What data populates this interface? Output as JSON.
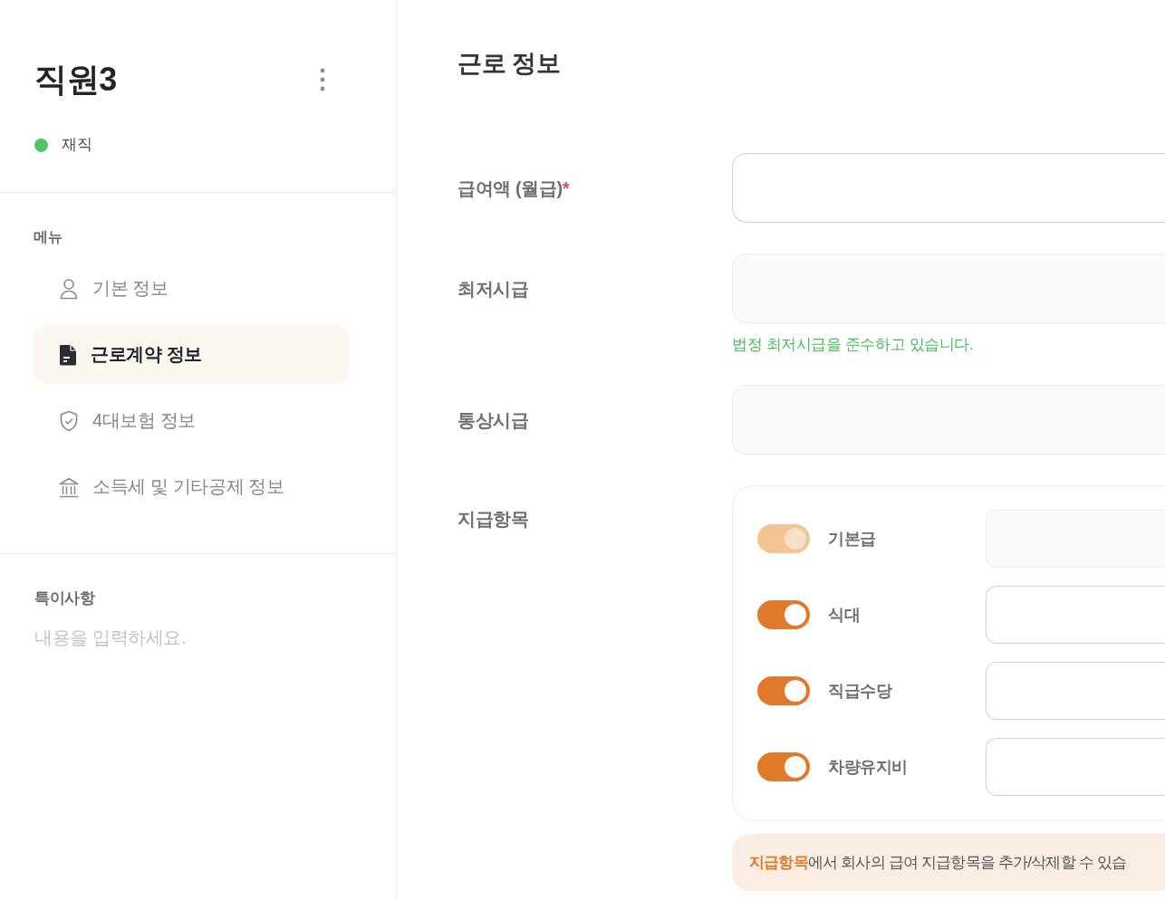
{
  "sidebar": {
    "employee_name": "직원3",
    "status": "재직",
    "menu_heading": "메뉴",
    "menu_items": [
      {
        "label": "기본 정보",
        "selected": false
      },
      {
        "label": "근로계약 정보",
        "selected": true
      },
      {
        "label": "4대보험 정보",
        "selected": false
      },
      {
        "label": "소득세 및 기타공제 정보",
        "selected": false
      }
    ],
    "notes": {
      "label": "특이사항",
      "placeholder": "내용을 입력하세요."
    }
  },
  "main": {
    "title": "근로 정보",
    "fields": [
      {
        "label": "급여액 (월급)",
        "required_mark": "*",
        "disabled": false
      },
      {
        "label": "최저시급",
        "disabled": true,
        "helper": "법정 최저시급을 준수하고 있습니다."
      },
      {
        "label": "통상시급",
        "disabled": true
      }
    ],
    "pay_items": {
      "label": "지급항목",
      "items": [
        {
          "label": "기본급",
          "on": true,
          "disabled": true
        },
        {
          "label": "식대",
          "on": true,
          "disabled": false
        },
        {
          "label": "직급수당",
          "on": true,
          "disabled": false
        },
        {
          "label": "차량유지비",
          "on": true,
          "disabled": false
        }
      ]
    },
    "notice": "**지급항목**에서 회사의 급여 지급항목을 추가/삭제할 수 있습"
  }
}
